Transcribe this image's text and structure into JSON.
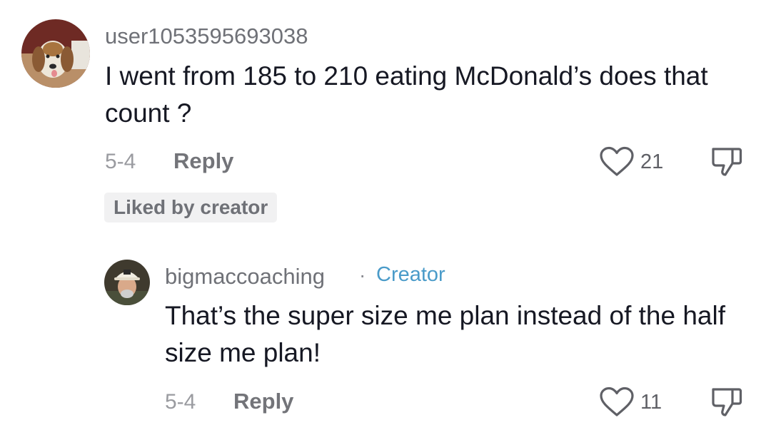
{
  "comments": [
    {
      "username": "user1053595693038",
      "text": "I went from 185 to 210 eating McDonald’s does that count ?",
      "date": "5-4",
      "reply_label": "Reply",
      "likes": "21",
      "badge": "Liked by creator"
    },
    {
      "username": "bigmaccoaching",
      "separator": "·",
      "role": "Creator",
      "text": "That’s the super size me plan instead of the half size me plan!",
      "date": "5-4",
      "reply_label": "Reply",
      "likes": "11"
    }
  ],
  "colors": {
    "text": "#161823",
    "muted": "#9a9ba0",
    "creator_accent": "#4a9bc9",
    "badge_bg": "#f1f1f2"
  },
  "icons": {
    "like": "heart-outline-icon",
    "dislike": "thumbs-down-outline-icon"
  }
}
